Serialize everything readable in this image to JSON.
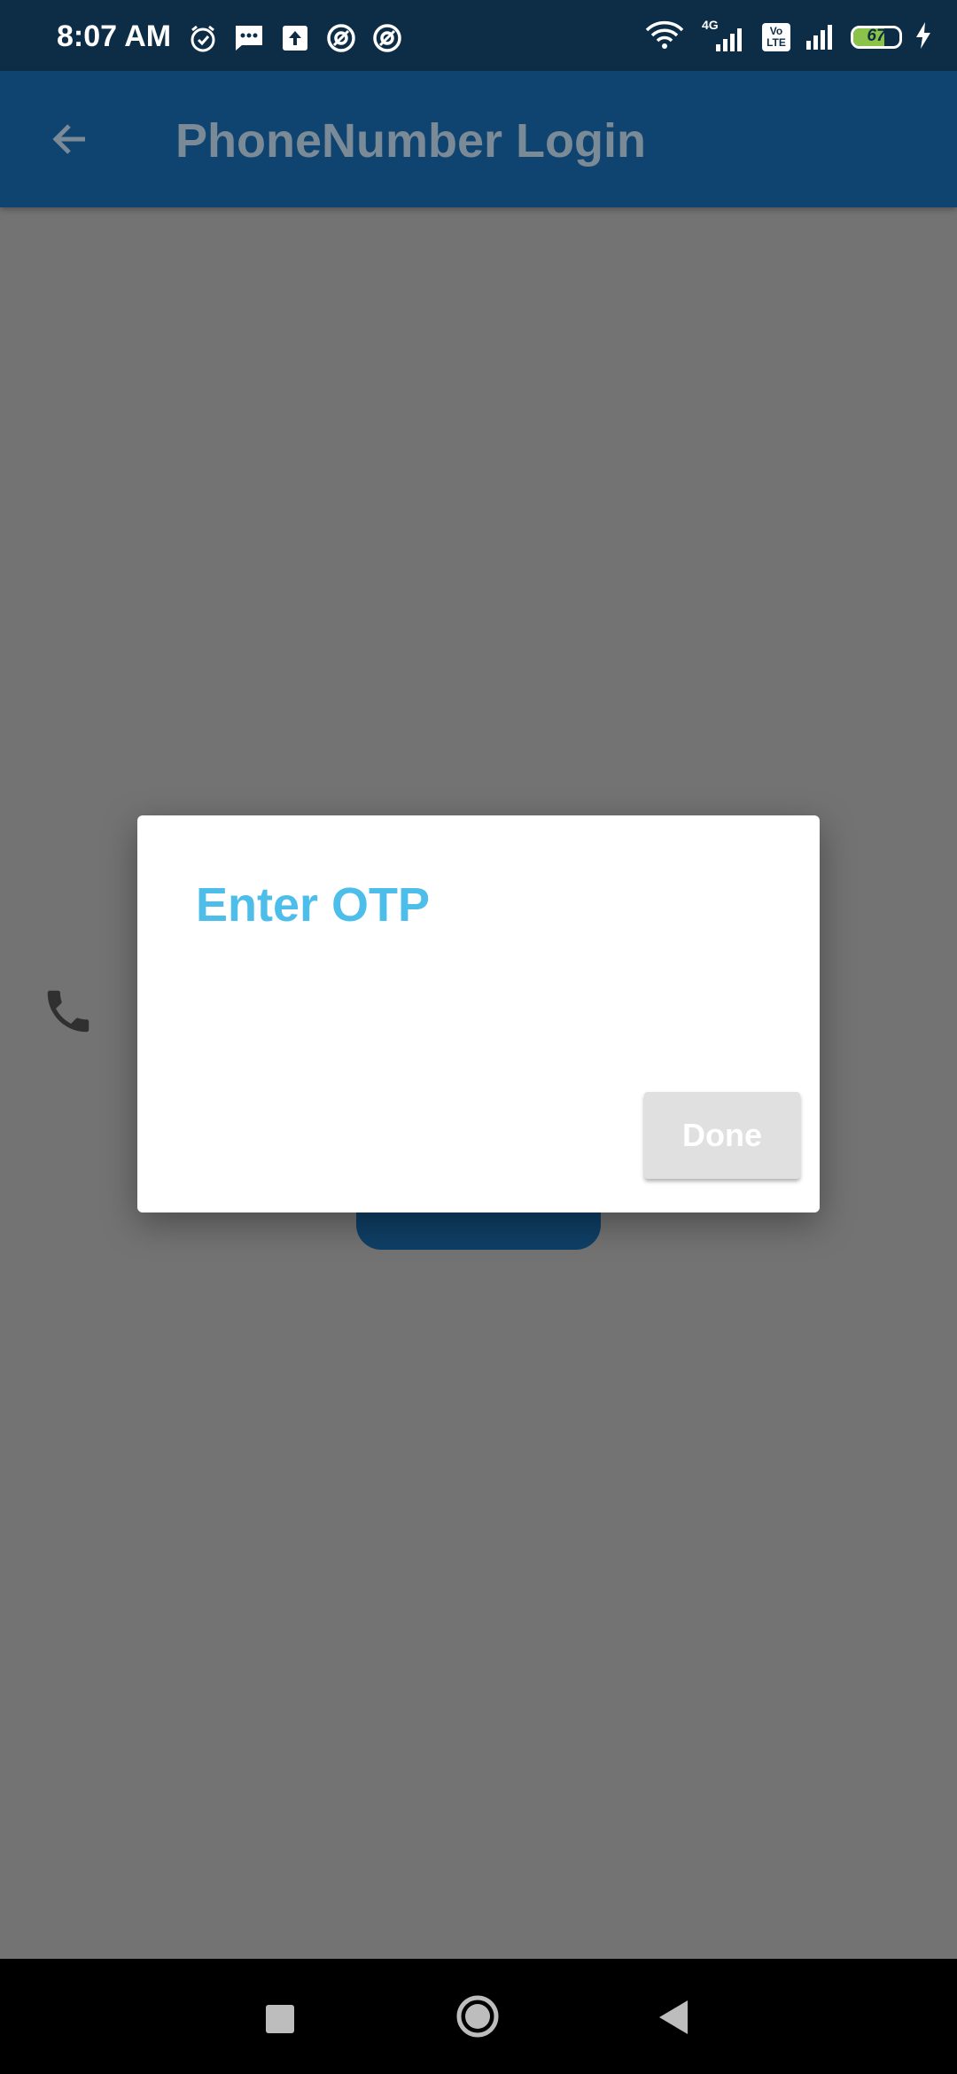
{
  "status_bar": {
    "time": "8:07 AM",
    "network_label": "4G",
    "volte_label": "Vo LTE",
    "battery_level": "67",
    "battery_fraction": 0.67,
    "icons_left": [
      "alarm-icon",
      "message-icon",
      "upload-icon",
      "at-sign-icon",
      "at-sign-icon"
    ],
    "icons_right": [
      "wifi-icon",
      "signal-4g-icon",
      "volte-icon",
      "signal-icon",
      "battery-icon",
      "charging-icon"
    ]
  },
  "app_bar": {
    "title": "PhoneNumber Login",
    "back_icon": "arrow-back-icon"
  },
  "background": {
    "phone_icon": "phone-icon",
    "sms_icon": "sms-icon"
  },
  "dialog": {
    "title": "Enter OTP",
    "done_label": "Done",
    "title_color": "#4dbdea"
  },
  "nav_bar": {
    "recents_icon": "square-icon",
    "home_icon": "circle-icon",
    "back_icon": "triangle-back-icon"
  },
  "colors": {
    "status_bar": "#0d2d47",
    "app_bar": "#0f4470",
    "scrim": "#737373",
    "battery_fill": "#8bc34a"
  }
}
